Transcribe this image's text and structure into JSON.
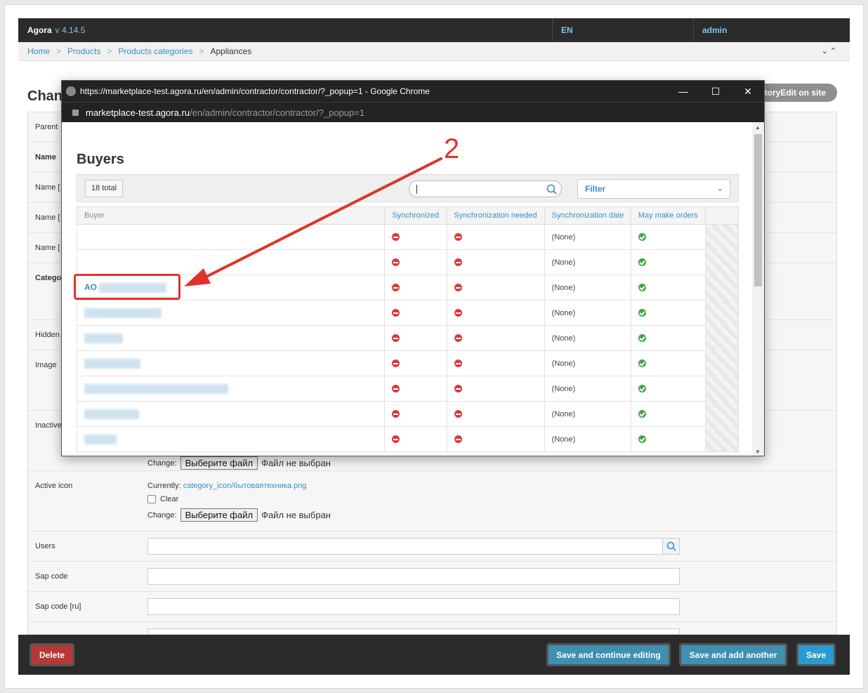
{
  "topbar": {
    "brand": "Agora",
    "version": "v 4.14.5",
    "lang": "EN",
    "user": "admin"
  },
  "breadcrumbs": {
    "home": "Home",
    "products": "Products",
    "categories": "Products categories",
    "current": "Appliances",
    "sep": ">",
    "toggles": "⌄⌃"
  },
  "page": {
    "title": "Chan",
    "view_on_site": "toryEdit on site"
  },
  "form": {
    "rows": [
      {
        "label": "Parent"
      },
      {
        "label": "Name"
      },
      {
        "label": "Name ["
      },
      {
        "label": "Name ["
      },
      {
        "label": "Name ["
      },
      {
        "label": "Catego"
      },
      {
        "label": "Hidden"
      },
      {
        "label": "Image"
      },
      {
        "label": "Inactive"
      }
    ],
    "inactive_change_text": "Change:",
    "active_icon": {
      "label": "Active icon",
      "currently_label": "Currently:",
      "currently_link": "category_icon/бытоваятехника.png",
      "clear_label": "Clear",
      "change_label": "Change:",
      "choose_btn": "Выберите файл",
      "no_file": "Файл не выбран"
    },
    "users_label": "Users",
    "sap_code_label": "Sap code",
    "sap_code_ru_label": "Sap code [ru]"
  },
  "footer": {
    "delete": "Delete",
    "save_continue": "Save and continue editing",
    "save_add": "Save and add another",
    "save": "Save"
  },
  "popup": {
    "window_title": "https://marketplace-test.agora.ru/en/admin/contractor/contractor/?_popup=1 - Google Chrome",
    "address_host": "marketplace-test.agora.ru",
    "address_path": "/en/admin/contractor/contractor/?_popup=1",
    "buyers_title": "Buyers",
    "total": "18 total",
    "filter": "Filter",
    "columns": [
      "Buyer",
      "Synchronized",
      "Synchronization needed",
      "Synchronization date",
      "May make orders"
    ],
    "rows": [
      {
        "buyer": "",
        "date": "(None)"
      },
      {
        "buyer": "",
        "date": "(None)"
      },
      {
        "buyer": "AO",
        "date": "(None)"
      },
      {
        "buyer": "",
        "date": "(None)"
      },
      {
        "buyer": "",
        "date": "(None)"
      },
      {
        "buyer": "",
        "date": "(None)"
      },
      {
        "buyer": "",
        "date": "(None)"
      },
      {
        "buyer": "",
        "date": "(None)"
      },
      {
        "buyer": "",
        "date": "(None)"
      }
    ]
  },
  "annotation": {
    "number": "2"
  },
  "colors": {
    "accent": "#3b8ec2",
    "danger": "#d93a3a",
    "ok": "#3fa843",
    "annotation": "#e0332b"
  }
}
